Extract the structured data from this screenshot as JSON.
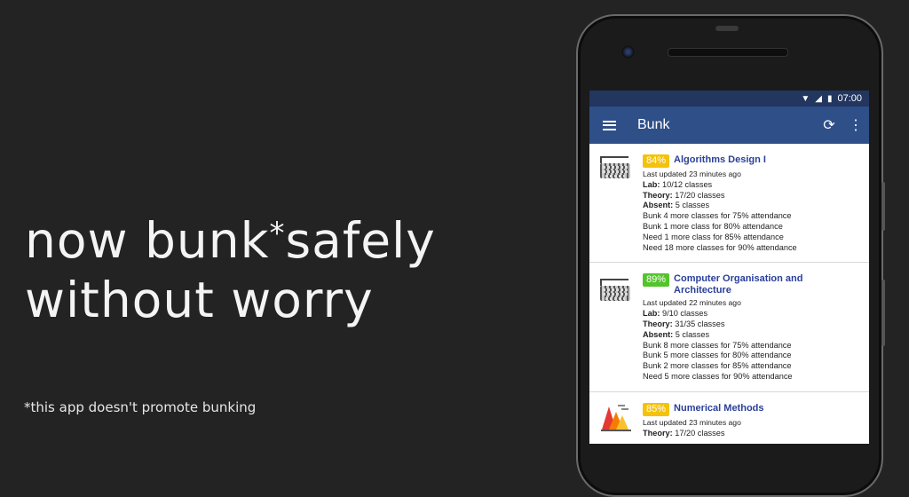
{
  "headline": {
    "line1_a": "now bunk",
    "line1_star": "*",
    "line1_b": "safely",
    "line2": "without worry"
  },
  "footnote": "*this app doesn't promote bunking",
  "status_bar": {
    "time": "07:00"
  },
  "app_bar": {
    "title": "Bunk",
    "menu_icon": "hamburger-icon",
    "refresh_icon": "refresh-icon",
    "more_icon": "more-vert-icon"
  },
  "colors": {
    "appbar": "#2f4f89",
    "statusbar": "#22365f",
    "badge_yellow": "#f4c20d",
    "badge_green": "#53c42b",
    "course_name": "#2a3f9a"
  },
  "courses": [
    {
      "icon": "keyboard-icon",
      "percent": "84%",
      "badge_color": "#f4c20d",
      "name": "Algorithms Design I",
      "updated": "Last updated 23 minutes ago",
      "lab_label": "Lab:",
      "lab": "10/12 classes",
      "theory_label": "Theory:",
      "theory": "17/20 classes",
      "absent_label": "Absent:",
      "absent": "5 classes",
      "bunk": [
        "Bunk 4 more classes for 75% attendance",
        "Bunk 1 more class for 80% attendance",
        "Need 1 more class for 85% attendance",
        "Need 18 more classes for 90% attendance"
      ]
    },
    {
      "icon": "keyboard-icon",
      "percent": "89%",
      "badge_color": "#53c42b",
      "name": "Computer Organisation and Architecture",
      "updated": "Last updated 22 minutes ago",
      "lab_label": "Lab:",
      "lab": "9/10 classes",
      "theory_label": "Theory:",
      "theory": "31/35 classes",
      "absent_label": "Absent:",
      "absent": "5 classes",
      "bunk": [
        "Bunk 8 more classes for 75% attendance",
        "Bunk 5 more classes for 80% attendance",
        "Bunk 2 more classes for 85% attendance",
        "Need 5 more classes for 90% attendance"
      ]
    },
    {
      "icon": "chart-icon",
      "percent": "85%",
      "badge_color": "#f4c20d",
      "name": "Numerical Methods",
      "updated": "Last updated 23 minutes ago",
      "theory_label": "Theory:",
      "theory": "17/20 classes"
    }
  ]
}
